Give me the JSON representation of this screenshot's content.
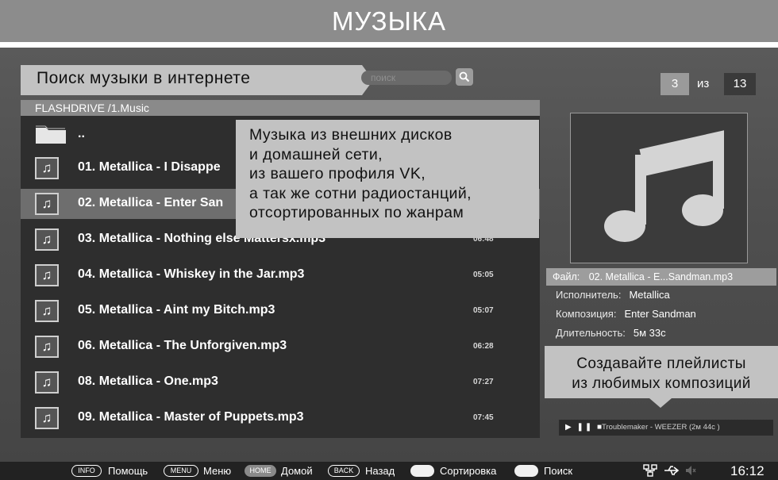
{
  "header": {
    "title": "МУЗЫКА"
  },
  "callouts": {
    "search_hint": "Поиск музыки в интернете",
    "sources_lines": [
      "Музыка из внешних дисков",
      "и домашней сети,",
      "из вашего профиля VK,",
      "а так же сотни радиостанций,",
      "отсортированных по жанрам"
    ],
    "playlist_lines": [
      "Создавайте плейлисты",
      "из любимых композиций"
    ]
  },
  "search": {
    "placeholder": "поиск",
    "button_icon": "search-icon"
  },
  "counter": {
    "current": "3",
    "of": "из",
    "total": "13"
  },
  "browser": {
    "path": "FLASHDRIVE /1.Music",
    "parent_label": "..",
    "tracks": [
      {
        "name": "01. Metallica - I Disappe",
        "duration": ""
      },
      {
        "name": "02. Metallica - Enter San",
        "duration": "",
        "selected": true
      },
      {
        "name": "03. Metallica - Nothing else Mattersx.mp3",
        "duration": "06:48"
      },
      {
        "name": "04. Metallica - Whiskey in the Jar.mp3",
        "duration": "05:05"
      },
      {
        "name": "05. Metallica - Aint my Bitch.mp3",
        "duration": "05:07"
      },
      {
        "name": "06. Metallica - The Unforgiven.mp3",
        "duration": "06:28"
      },
      {
        "name": "08. Metallica - One.mp3",
        "duration": "07:27"
      },
      {
        "name": "09. Metallica - Master of Puppets.mp3",
        "duration": "07:45"
      }
    ]
  },
  "info": {
    "file_label": "Файл:",
    "file_value": "02. Metallica - E...Sandman.mp3",
    "artist_label": "Исполнитель:",
    "artist_value": "Metallica",
    "composition_label": "Композиция:",
    "composition_value": "Enter Sandman",
    "duration_label": "Длительность:",
    "duration_value": "5м 33с"
  },
  "player": {
    "controls": "▶ ❚❚ ■",
    "now_playing": "Troublemaker - WEEZER (2м 44с )"
  },
  "bottombar": {
    "info_key": "INFO",
    "info_label": "Помощь",
    "menu_key": "MENU",
    "menu_label": "Меню",
    "home_key": "HOME",
    "home_label": "Домой",
    "back_key": "BACK",
    "back_label": "Назад",
    "sort_label": "Сортировка",
    "search_label": "Поиск",
    "clock": "16:12"
  },
  "colors": {
    "accent": "#9d9d9d",
    "callout_bg": "#c2c2c2",
    "panel_bg": "#2e2e2e"
  }
}
